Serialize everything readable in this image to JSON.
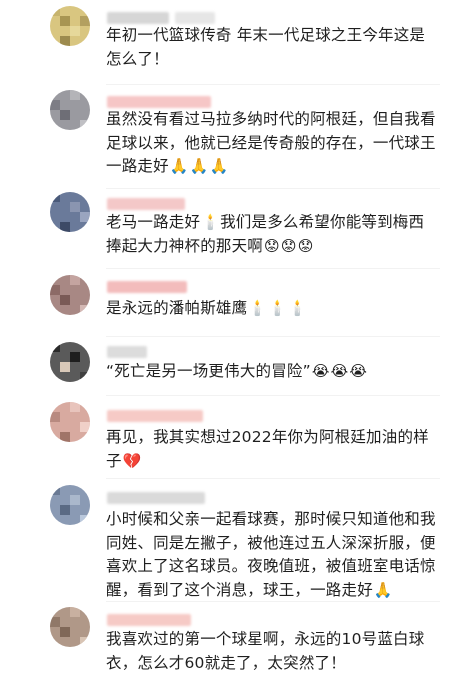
{
  "comments": [
    {
      "text": "年初一代篮球传奇 年末一代足球之王今年这是怎么了！",
      "emojis": [],
      "avatar_color": "#b8a86a",
      "name_color": "#d4d4d4"
    },
    {
      "text": "虽然没有看过马拉多纳时代的阿根廷，但自我看足球以来，他就已经是传奇般的存在，一代球王一路走好",
      "emojis": [
        "🙏",
        "🙏",
        "🙏"
      ],
      "avatar_color": "#8f8f95",
      "name_color": "#f6c2c2"
    },
    {
      "text": "老马一路走好",
      "text2": "我们是多么希望你能等到梅西捧起大力神杯的那天啊",
      "emojis_mid": [
        "🕯️"
      ],
      "emojis": [
        "😟",
        "😟",
        "😟"
      ],
      "avatar_color": "#5a6a8a",
      "name_color": "#f3c5c5"
    },
    {
      "text": "是永远的潘帕斯雄鹰",
      "emojis": [
        "🕯️",
        "🕯️",
        "🕯️"
      ],
      "avatar_color": "#9e7a76",
      "name_color": "#f0b9b9"
    },
    {
      "text": "“死亡是另一场更伟大的冒险”",
      "emojis": [
        "😭",
        "😭",
        "😭"
      ],
      "avatar_color": "#3b3b3b",
      "name_color": "#dadada"
    },
    {
      "text": "再见，我其实想过2022年你为阿根廷加油的样子",
      "emojis": [
        "💔"
      ],
      "avatar_color": "#c79a8f",
      "name_color": "#f6c7c4"
    },
    {
      "text": "小时候和父亲一起看球赛，那时候只知道他和我同姓、同是左撇子，被他连过五人深深折服，便喜欢上了这名球员。夜晚值班，被值班室电话惊醒，看到了这个消息，球王，一路走好",
      "emojis": [
        "🙏"
      ],
      "avatar_color": "#7b8ca6",
      "name_color": "#d8d8d8"
    },
    {
      "text": "我喜欢过的第一个球星啊，永远的10号蓝白球衣，怎么才60就走了，太突然了！",
      "emojis": [],
      "avatar_color": "#a08a7c",
      "name_color": "#f6c8c4"
    }
  ]
}
